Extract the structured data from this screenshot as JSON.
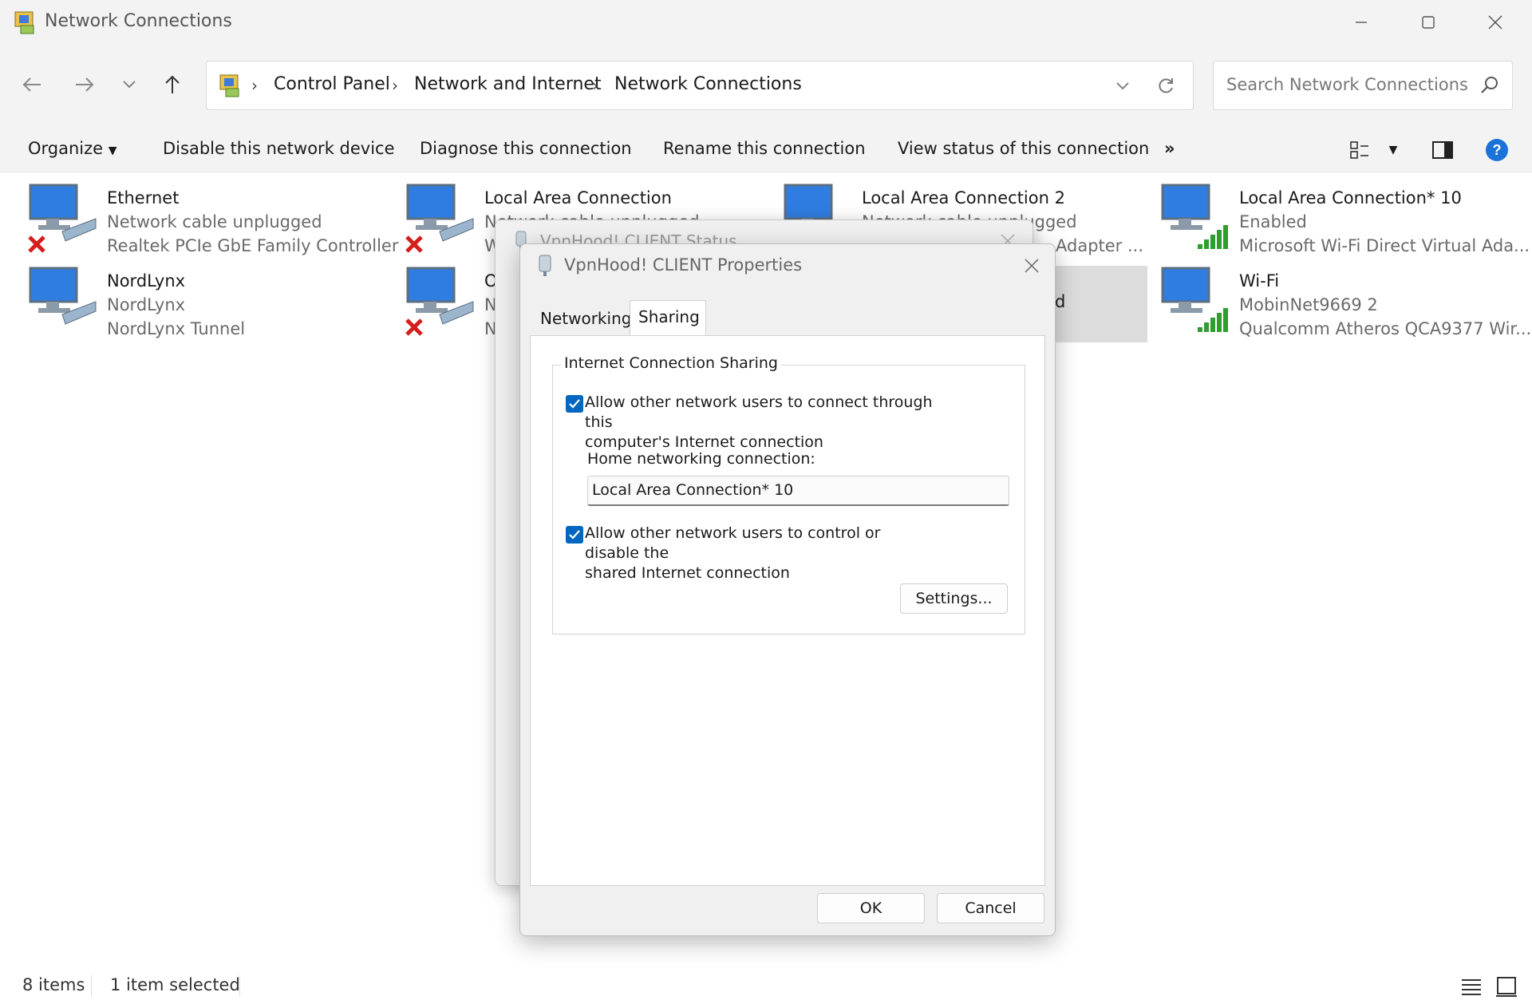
{
  "window": {
    "title": "Network Connections"
  },
  "nav": {
    "breadcrumb": [
      "Control Panel",
      "Network and Internet",
      "Network Connections"
    ],
    "search_placeholder": "Search Network Connections"
  },
  "commands": {
    "organize": "Organize",
    "disable": "Disable this network device",
    "diagnose": "Diagnose this connection",
    "rename": "Rename this connection",
    "view_status": "View status of this connection",
    "more": "»"
  },
  "items": [
    {
      "name": "Ethernet",
      "line2": "Network cable unplugged",
      "line3": "Realtek PCIe GbE Family Controller",
      "status_icon": "red-x-icon"
    },
    {
      "name": "Local Area Connection",
      "line2": "Network cable unplugged",
      "line3": "W",
      "status_icon": "red-x-icon"
    },
    {
      "name": "Local Area Connection 2",
      "line2": "Network cable unplugged",
      "line3": "Adapter ...",
      "status_icon": "none"
    },
    {
      "name": "Local Area Connection* 10",
      "line2": "Enabled",
      "line3": "Microsoft Wi-Fi Direct Virtual Ada...",
      "status_icon": "signal-bars-icon"
    },
    {
      "name": "NordLynx",
      "line2": "NordLynx",
      "line3": "NordLynx Tunnel",
      "status_icon": "none"
    },
    {
      "name": "O",
      "line2": "N",
      "line3": "N",
      "status_icon": "red-x-icon"
    },
    {
      "name": "",
      "line2": "d",
      "line3": "",
      "status_icon": "none"
    },
    {
      "name": "Wi-Fi",
      "line2": "MobinNet9669 2",
      "line3": "Qualcomm Atheros QCA9377 Wir...",
      "status_icon": "signal-bars-icon"
    }
  ],
  "status": {
    "items_count": "8 items",
    "selected": "1 item selected"
  },
  "bg_dialog": {
    "title": "VpnHood! CLIENT Status"
  },
  "dialog": {
    "title": "VpnHood! CLIENT Properties",
    "tabs": [
      "Networking",
      "Sharing"
    ],
    "active_tab": "Sharing",
    "group_label": "Internet Connection Sharing",
    "checkbox1": {
      "checked": true,
      "line1": "Allow other network users to connect through this",
      "line2": "computer's Internet connection"
    },
    "home_label": "Home networking connection:",
    "home_value": "Local Area Connection* 10",
    "checkbox2": {
      "checked": true,
      "line1": "Allow other network users to control or disable the",
      "line2": "shared Internet connection"
    },
    "settings_button": "Settings...",
    "ok_button": "OK",
    "cancel_button": "Cancel"
  },
  "colors": {
    "accent": "#0067c0",
    "error": "#d41e1e",
    "signal": "#2e9e2e"
  }
}
